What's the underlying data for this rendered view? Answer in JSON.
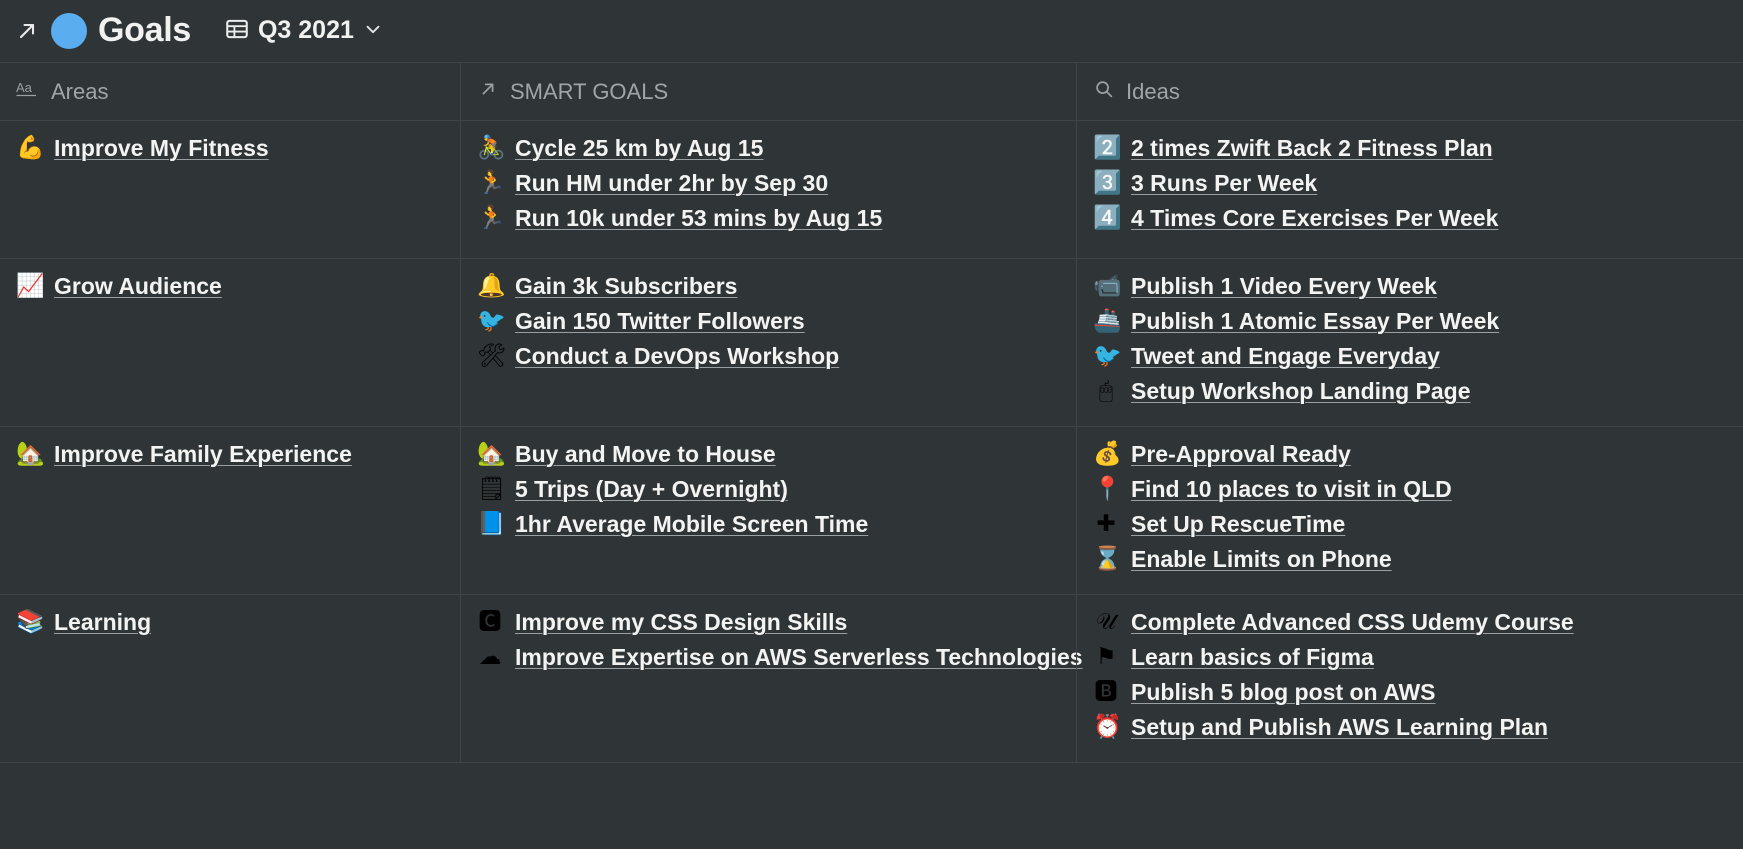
{
  "header": {
    "expand_icon": "arrow-up-right-icon",
    "page_icon": "blue-circle-icon",
    "title": "Goals",
    "view": {
      "icon": "table-icon",
      "label": "Q3 2021",
      "chevron": "chevron-down-icon"
    }
  },
  "accent_colors": {
    "page_dot": "#5aaef0",
    "background": "#2f3437",
    "border": "#414446",
    "text": "#f3f3f2",
    "muted_text": "#a0a5a8"
  },
  "table": {
    "columns": [
      {
        "icon": "text-property-icon",
        "icon_glyph": "Aa",
        "label": "Areas"
      },
      {
        "icon": "relation-arrow-icon",
        "icon_glyph": "↗",
        "label": "SMART GOALS"
      },
      {
        "icon": "search-icon",
        "icon_glyph": "⚲",
        "label": "Ideas"
      }
    ],
    "rows": [
      {
        "area": {
          "emoji": "💪",
          "emoji_name": "flexed-biceps-emoji",
          "label": "Improve My Fitness"
        },
        "smart_goals": [
          {
            "emoji": "🚴",
            "emoji_name": "cyclist-emoji",
            "label": "Cycle 25 km by Aug 15"
          },
          {
            "emoji": "🏃",
            "emoji_name": "runner-emoji",
            "label": "Run HM under 2hr by Sep 30"
          },
          {
            "emoji": "🏃",
            "emoji_name": "runner-emoji",
            "label": "Run 10k under 53 mins by Aug 15"
          }
        ],
        "ideas": [
          {
            "emoji": "2️⃣",
            "emoji_name": "keycap-two-emoji",
            "label": "2 times Zwift Back 2 Fitness Plan"
          },
          {
            "emoji": "3️⃣",
            "emoji_name": "keycap-three-emoji",
            "label": "3 Runs Per Week"
          },
          {
            "emoji": "4️⃣",
            "emoji_name": "keycap-four-emoji",
            "label": "4 Times Core Exercises Per Week"
          }
        ]
      },
      {
        "area": {
          "emoji": "📈",
          "emoji_name": "chart-increasing-emoji",
          "label": "Grow Audience"
        },
        "smart_goals": [
          {
            "emoji": "🔔",
            "emoji_name": "bell-emoji",
            "label": "Gain 3k Subscribers"
          },
          {
            "emoji": "🐦",
            "emoji_name": "twitter-bird-icon",
            "label": "Gain 150 Twitter Followers"
          },
          {
            "emoji": "🛠",
            "emoji_name": "hammer-and-wrench-emoji",
            "label": "Conduct a DevOps Workshop"
          }
        ],
        "ideas": [
          {
            "emoji": "📹",
            "emoji_name": "video-camera-emoji",
            "label": "Publish 1 Video Every Week"
          },
          {
            "emoji": "🚢",
            "emoji_name": "ship-emoji",
            "label": "Publish 1 Atomic Essay Per Week"
          },
          {
            "emoji": "🐦",
            "emoji_name": "red-bird-emoji",
            "label": "Tweet and Engage Everyday"
          },
          {
            "emoji": "🖱",
            "emoji_name": "book-and-mouse-icon",
            "label": "Setup Workshop Landing Page"
          }
        ]
      },
      {
        "area": {
          "emoji": "🏡",
          "emoji_name": "house-with-garden-emoji",
          "label": "Improve Family Experience"
        },
        "smart_goals": [
          {
            "emoji": "🏡",
            "emoji_name": "house-with-garden-emoji",
            "label": "Buy and Move to House"
          },
          {
            "emoji": "🗒",
            "emoji_name": "spiral-notepad-emoji",
            "label": "5 Trips (Day + Overnight)"
          },
          {
            "emoji": "📘",
            "emoji_name": "blue-book-emoji",
            "label": "1hr Average Mobile Screen Time"
          }
        ],
        "ideas": [
          {
            "emoji": "💰",
            "emoji_name": "money-bag-emoji",
            "label": "Pre-Approval Ready"
          },
          {
            "emoji": "📍",
            "emoji_name": "round-pushpin-emoji",
            "label": "Find 10 places to visit in QLD"
          },
          {
            "emoji": "✚",
            "emoji_name": "rescuetime-logo-icon",
            "label": "Set Up RescueTime"
          },
          {
            "emoji": "⌛",
            "emoji_name": "hourglass-app-icon",
            "label": "Enable Limits on Phone"
          }
        ]
      },
      {
        "area": {
          "emoji": "📚",
          "emoji_name": "books-emoji",
          "label": "Learning"
        },
        "smart_goals": [
          {
            "emoji": "🅲",
            "emoji_name": "css3-logo-icon",
            "label": "Improve my CSS Design Skills"
          },
          {
            "emoji": "☁",
            "emoji_name": "aws-logo-icon",
            "label": "Improve Expertise on AWS Serverless Technologies"
          }
        ],
        "ideas": [
          {
            "emoji": "𝒰",
            "emoji_name": "udemy-logo-icon",
            "label": "Complete Advanced CSS Udemy Course"
          },
          {
            "emoji": "⚑",
            "emoji_name": "figma-logo-icon",
            "label": "Learn basics of Figma"
          },
          {
            "emoji": "🅱",
            "emoji_name": "blogger-logo-icon",
            "label": "Publish 5 blog post on AWS"
          },
          {
            "emoji": "⏰",
            "emoji_name": "alarm-clock-emoji",
            "label": "Setup and Publish AWS Learning Plan"
          }
        ]
      }
    ]
  }
}
